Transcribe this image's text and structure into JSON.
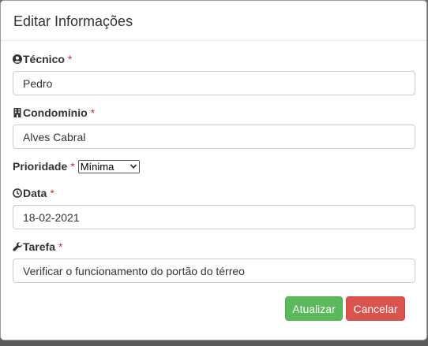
{
  "modal": {
    "title": "Editar Informações"
  },
  "fields": {
    "tecnico": {
      "label": "Técnico",
      "required": "*",
      "value": "Pedro"
    },
    "condominio": {
      "label": "Condomínio",
      "required": "*",
      "value": "Alves Cabral"
    },
    "prioridade": {
      "label": "Prioridade",
      "required": "*",
      "selected": "Mínima"
    },
    "data": {
      "label": "Data",
      "required": "*",
      "value": "18-02-2021"
    },
    "tarefa": {
      "label": "Tarefa",
      "required": "*",
      "value": "Verificar o funcionamento do portão do térreo"
    }
  },
  "buttons": {
    "update": "Atualizar",
    "cancel": "Cancelar"
  },
  "icons": {
    "tecnico": "user-circle-icon",
    "condominio": "building-icon",
    "data": "clock-icon",
    "tarefa": "wrench-icon"
  },
  "colors": {
    "success": "#5cb85c",
    "danger": "#d9534f",
    "required": "#c9302c"
  }
}
